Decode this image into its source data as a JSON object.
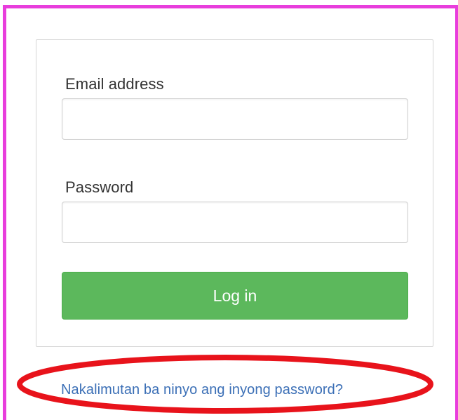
{
  "login_form": {
    "email_label": "Email address",
    "email_value": "",
    "email_placeholder": "",
    "password_label": "Password",
    "password_value": "",
    "password_placeholder": "",
    "login_button_label": "Log in",
    "forgot_password_link": "Nakalimutan ba ninyo ang inyong password?"
  },
  "colors": {
    "frame_border": "#e83ddc",
    "login_button": "#5cb85c",
    "link": "#3b6fb6",
    "highlight_ellipse": "#e8131b"
  }
}
